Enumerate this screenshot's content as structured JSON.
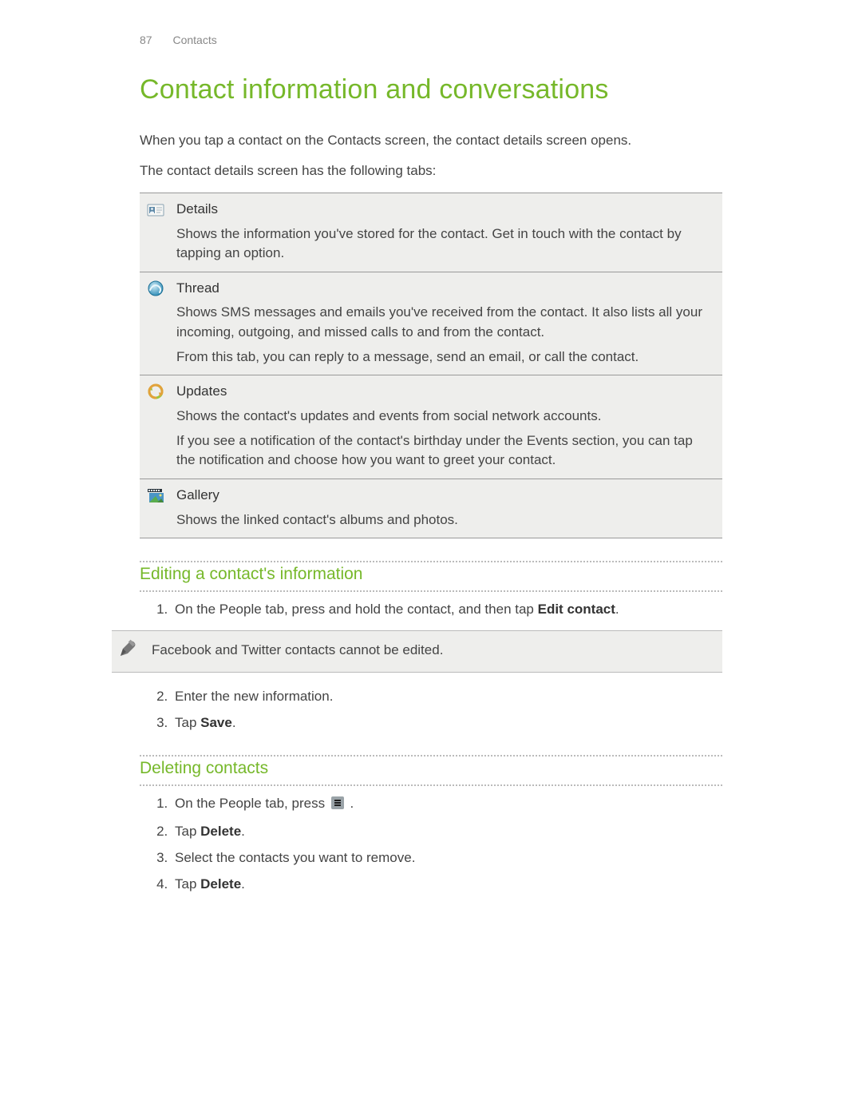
{
  "header": {
    "page_number": "87",
    "section": "Contacts"
  },
  "title": "Contact information and conversations",
  "intro": [
    "When you tap a contact on the Contacts screen, the contact details screen opens.",
    "The contact details screen has the following tabs:"
  ],
  "tabs": [
    {
      "icon": "details-card-icon",
      "title": "Details",
      "paragraphs": [
        "Shows the information you've stored for the contact. Get in touch with the contact by tapping an option."
      ]
    },
    {
      "icon": "globe-swirl-icon",
      "title": "Thread",
      "paragraphs": [
        "Shows SMS messages and emails you've received from the contact. It also lists all your incoming, outgoing, and missed calls to and from the contact.",
        "From this tab, you can reply to a message, send an email, or call the contact."
      ]
    },
    {
      "icon": "refresh-circle-icon",
      "title": "Updates",
      "paragraphs": [
        "Shows the contact's updates and events from social network accounts.",
        "If you see a notification of the contact's birthday under the Events section, you can tap the notification and choose how you want to greet your contact."
      ]
    },
    {
      "icon": "film-photo-icon",
      "title": "Gallery",
      "paragraphs": [
        "Shows the linked contact's albums and photos."
      ]
    }
  ],
  "sections": {
    "editing": {
      "heading": "Editing a contact's information",
      "step1_pre": "On the People tab, press and hold the contact, and then tap ",
      "step1_bold": "Edit contact",
      "step1_post": ".",
      "note": "Facebook and Twitter contacts cannot be edited.",
      "step2": "Enter the new information.",
      "step3_pre": "Tap ",
      "step3_bold": "Save",
      "step3_post": "."
    },
    "deleting": {
      "heading": "Deleting contacts",
      "step1_pre": "On the People tab, press ",
      "step1_post": ".",
      "step2_pre": "Tap ",
      "step2_bold": "Delete",
      "step2_post": ".",
      "step3": "Select the contacts you want to remove.",
      "step4_pre": "Tap ",
      "step4_bold": "Delete",
      "step4_post": "."
    }
  }
}
